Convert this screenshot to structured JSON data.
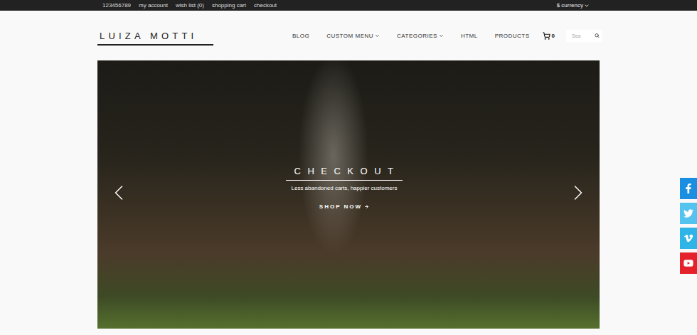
{
  "top_bar": {
    "links": [
      "123456789",
      "my account",
      "wish list (0)",
      "shopping cart",
      "checkout"
    ],
    "currency": "$ currency"
  },
  "logo": "LUIZA MOTTI",
  "nav": [
    {
      "label": "BLOG",
      "dropdown": false
    },
    {
      "label": "CUSTOM MENU",
      "dropdown": true
    },
    {
      "label": "CATEGORIES",
      "dropdown": true
    },
    {
      "label": "HTML",
      "dropdown": false
    },
    {
      "label": "PRODUCTS",
      "dropdown": false
    }
  ],
  "cart": {
    "count": "0"
  },
  "search": {
    "placeholder": "Sea"
  },
  "hero": {
    "title": "CHECKOUT",
    "subtitle": "Less abandoned carts, happier customers",
    "cta": "SHOP NOW"
  },
  "social": [
    {
      "kind": "facebook",
      "color": "#1a8ee1"
    },
    {
      "kind": "twitter",
      "color": "#55c3f0"
    },
    {
      "kind": "vimeo",
      "color": "#2fb4e8"
    },
    {
      "kind": "youtube",
      "color": "#e5212b"
    }
  ]
}
